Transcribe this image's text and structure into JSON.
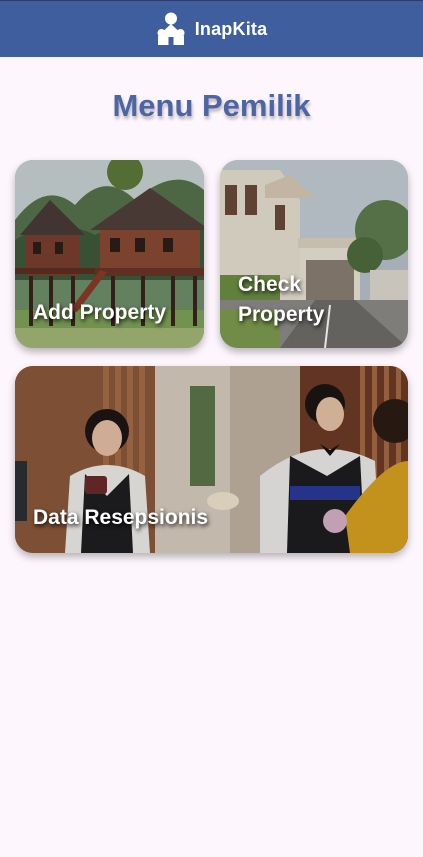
{
  "app": {
    "name": "InapKita",
    "logo_icon": "house-person-icon"
  },
  "page": {
    "title": "Menu Pemilik"
  },
  "menu": {
    "add_property": {
      "label": "Add Property",
      "image": "traditional-wooden-house-photo"
    },
    "check_property": {
      "label": "Check Property",
      "image": "colonial-building-photo"
    },
    "data_resepsionis": {
      "label": "Data Resepsionis",
      "image": "hotel-receptionists-photo"
    }
  },
  "colors": {
    "appbar": "#3f5e9e",
    "title": "#4d65a3",
    "background": "#fdf6fd"
  }
}
